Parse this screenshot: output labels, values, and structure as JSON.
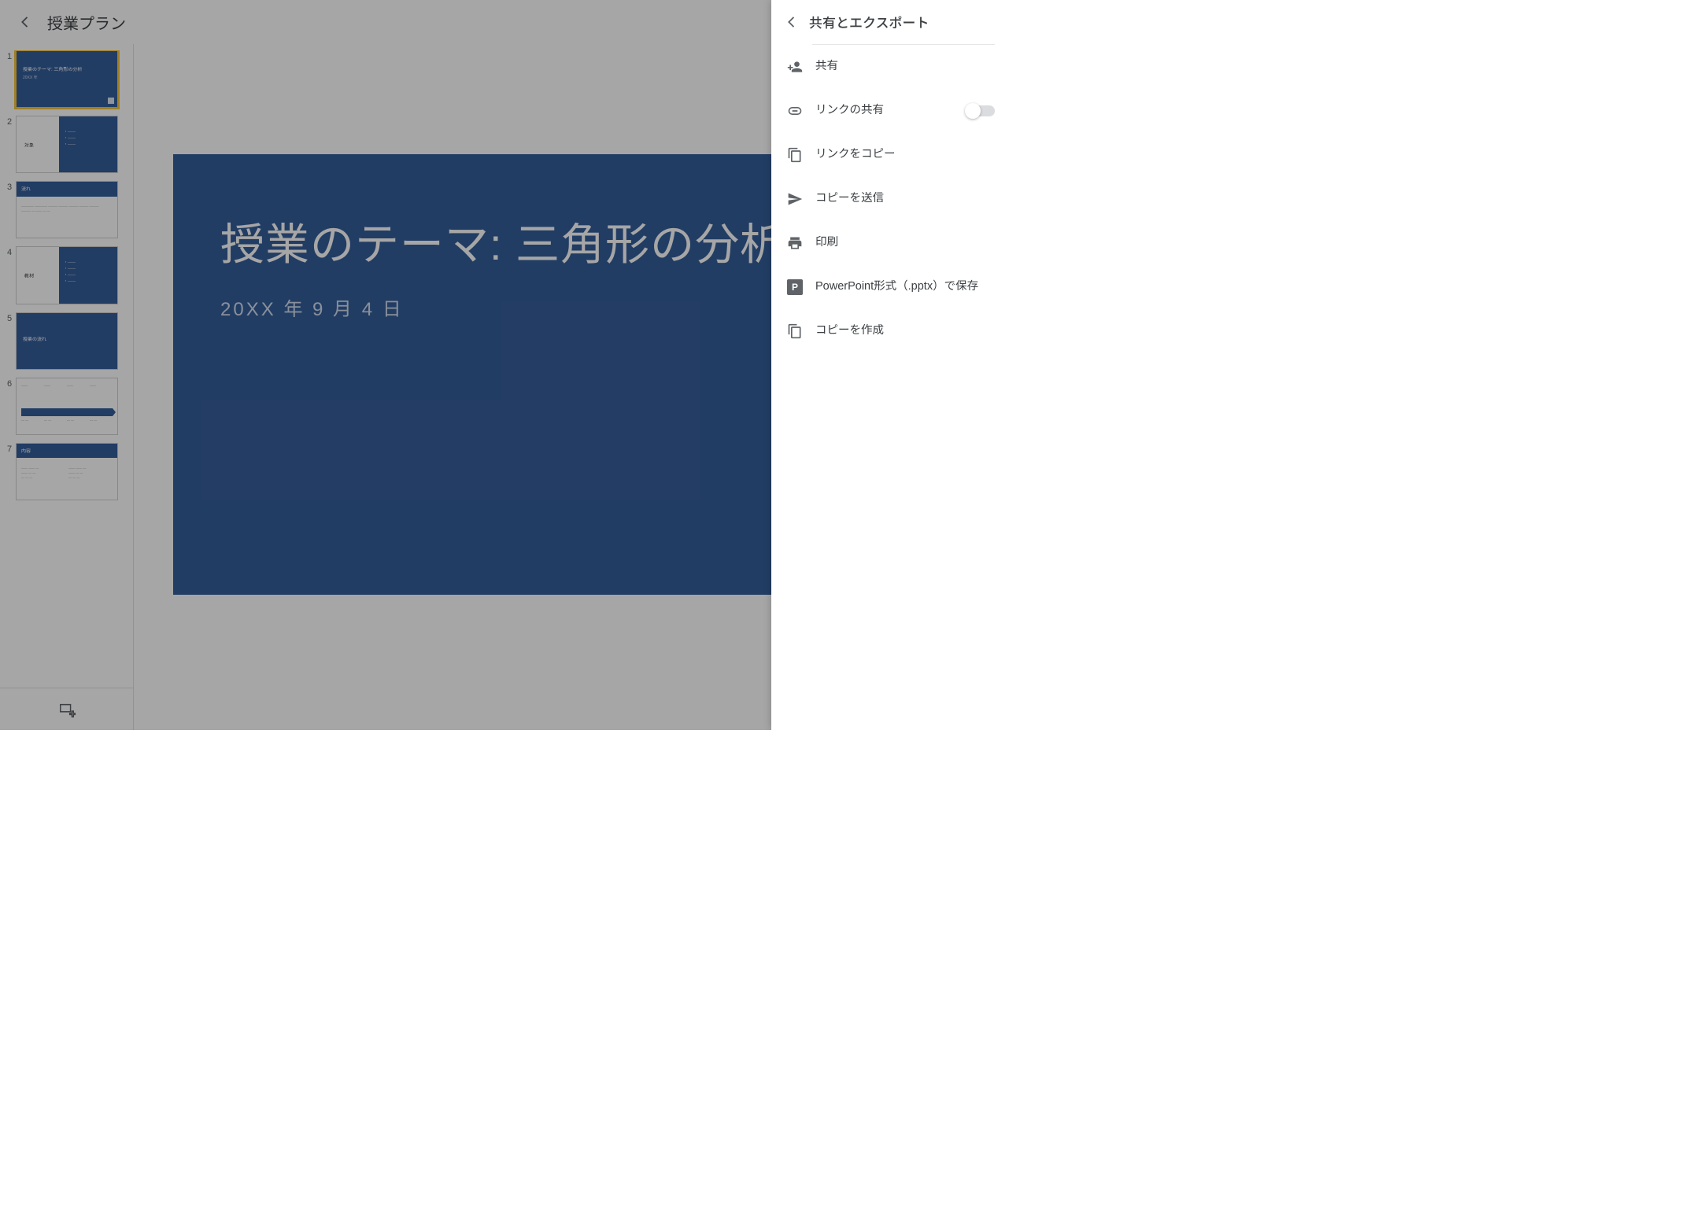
{
  "header": {
    "doc_title": "授業プラン"
  },
  "panel": {
    "title": "共有とエクスポート",
    "items": {
      "share": "共有",
      "link_sharing": "リンクの共有",
      "copy_link": "リンクをコピー",
      "send_copy": "コピーを送信",
      "print": "印刷",
      "save_pptx": "PowerPoint形式（.pptx）で保存",
      "make_copy": "コピーを作成"
    },
    "link_sharing_on": false
  },
  "slide": {
    "title_line": "授業のテーマ: 三角形の分析",
    "subtitle": "20XX 年 9 月 4 日"
  },
  "thumbs": [
    {
      "n": "1",
      "kind": "title",
      "title": "授業のテーマ: 三角形の分析",
      "sub": "20XX 年"
    },
    {
      "n": "2",
      "kind": "split",
      "left": "対象"
    },
    {
      "n": "3",
      "kind": "bluebar",
      "bar": "流れ"
    },
    {
      "n": "4",
      "kind": "split",
      "left": "教材"
    },
    {
      "n": "5",
      "kind": "blue",
      "title": "授業の流れ"
    },
    {
      "n": "6",
      "kind": "timeline"
    },
    {
      "n": "7",
      "kind": "bluebar-cols",
      "bar": "内容"
    }
  ],
  "colors": {
    "slide_blue": "#355e9a",
    "select_ring": "#f6c338"
  }
}
